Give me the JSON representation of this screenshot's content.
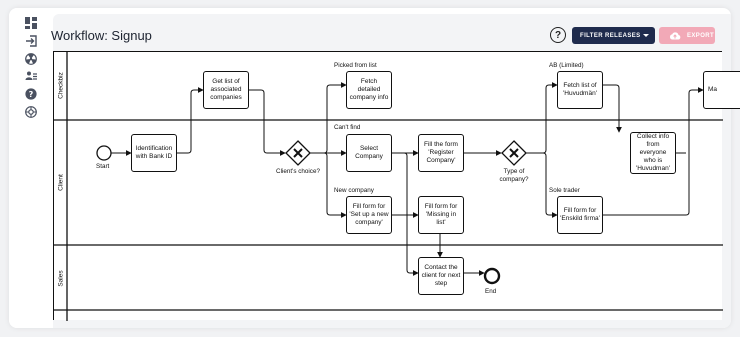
{
  "page": {
    "title": "Workflow: Signup"
  },
  "toolbar": {
    "help_label": "?",
    "filter_label": "FILTER RELEASES",
    "export_label": "EXPORT"
  },
  "sidebar": {
    "icons": [
      "dashboard-icon",
      "login-icon",
      "radiation-icon",
      "users-icon",
      "help-icon",
      "globe-icon"
    ]
  },
  "lanes": [
    "Checkbiz",
    "Client",
    "Sales"
  ],
  "tasks": {
    "identification": "Identification with Bank ID",
    "get_list": "Get list of associated companies",
    "fetch_detailed": "Fetch detailed company info",
    "select_company": "Select Company",
    "fill_register": "Fill the form 'Register Company'",
    "fill_new": "Fill form for 'Set up a new company'",
    "fill_missing": "Fill form for 'Missing in list'",
    "contact_client": "Contact the client for next step",
    "fetch_list": "Fetch list of 'Huvudmän'",
    "collect_info": "Collect info from everyone who is 'Huvudman'",
    "fill_enskild": "Fill form for 'Enskild firma'",
    "partial": "Ma"
  },
  "events": {
    "start": "Start",
    "end": "End"
  },
  "gateways": {
    "clients_choice": "Client's choice?",
    "type_of_company": "Type of company?"
  },
  "flow_labels": {
    "picked_from_list": "Picked from list",
    "cant_find": "Can't find",
    "new_company": "New company",
    "ab_limited": "AB (Limited)",
    "sole_trader": "Sole trader"
  }
}
